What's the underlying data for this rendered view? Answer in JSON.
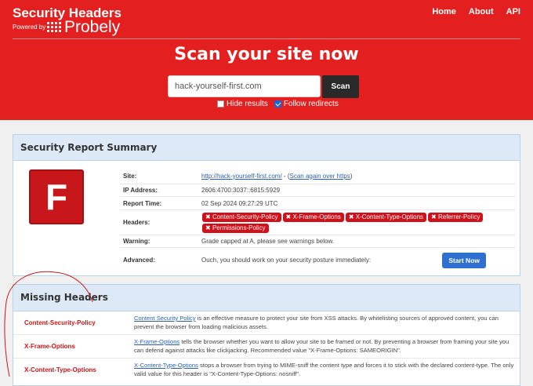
{
  "header": {
    "brand": "Security Headers",
    "powered_by": "Powered by",
    "logo_word": "Probely",
    "nav": [
      "Home",
      "About",
      "API"
    ]
  },
  "scan": {
    "title": "Scan your site now",
    "input_value": "hack-yourself-first.com",
    "button": "Scan",
    "hide_results": "Hide results",
    "hide_results_checked": false,
    "follow_redirects": "Follow redirects",
    "follow_redirects_checked": true
  },
  "summary": {
    "title": "Security Report Summary",
    "grade": "F",
    "site_label": "Site:",
    "site_url": "http://hack-yourself-first.com/",
    "site_sep": " - (",
    "scan_again": "Scan again over https",
    "site_close": ")",
    "ip_label": "IP Address:",
    "ip_value": "2606:4700:3037::6815:5929",
    "time_label": "Report Time:",
    "time_value": "02 Sep 2024 09:27:29 UTC",
    "headers_label": "Headers:",
    "headers": [
      "Content-Security-Policy",
      "X-Frame-Options",
      "X-Content-Type-Options",
      "Referrer-Policy",
      "Permissions-Policy"
    ],
    "warning_label": "Warning:",
    "warning_value": "Grade capped at A, please see warnings below.",
    "advanced_label": "Advanced:",
    "advanced_value": "Ouch, you should work on your security posture immediately:",
    "start_now": "Start Now"
  },
  "missing": {
    "title": "Missing Headers",
    "rows": [
      {
        "name": "Content-Security-Policy",
        "link": "Content Security Policy",
        "desc": " is an effective measure to protect your site from XSS attacks. By whitelisting sources of approved content, you can prevent the browser from loading malicious assets."
      },
      {
        "name": "X-Frame-Options",
        "link": "X-Frame-Options",
        "desc": " tells the browser whether you want to allow your site to be framed or not. By preventing a browser from framing your site you can defend against attacks like clickjacking. Recommended value \"X-Frame-Options: SAMEORIGIN\"."
      },
      {
        "name": "X-Content-Type-Options",
        "link": "X-Content-Type-Options",
        "desc": " stops a browser from trying to MIME-sniff the content type and forces it to stick with the declared content-type. The only valid value for this header is \"X-Content-Type-Options: nosniff\"."
      }
    ]
  },
  "colors": {
    "brand_red": "#e3201f",
    "grade_red": "#c8171b",
    "panel_header": "#dde9f6",
    "button_blue": "#2f6fd0"
  }
}
